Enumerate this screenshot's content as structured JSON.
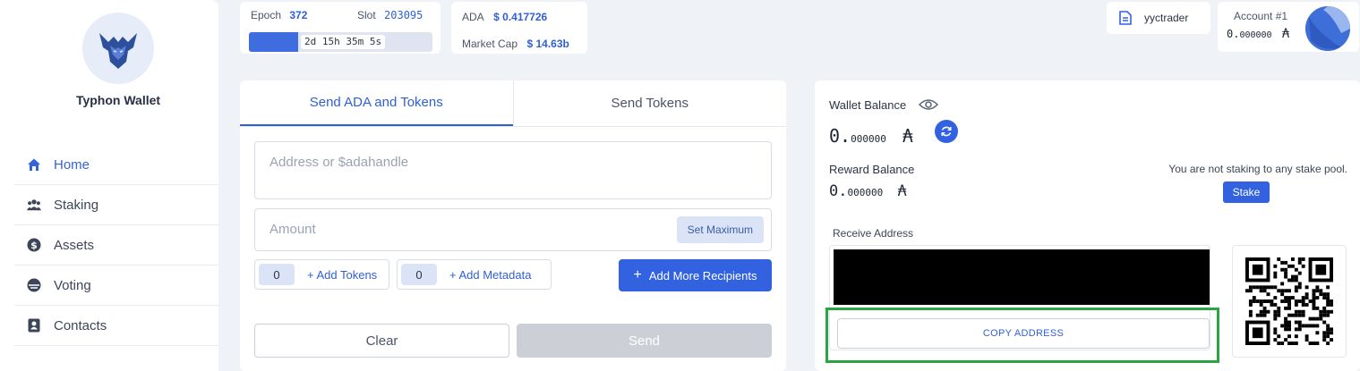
{
  "sidebar": {
    "brand": "Typhon Wallet",
    "items": [
      {
        "label": "Home",
        "icon": "home-icon",
        "active": true
      },
      {
        "label": "Staking",
        "icon": "users-icon",
        "active": false
      },
      {
        "label": "Assets",
        "icon": "dollar-icon",
        "active": false
      },
      {
        "label": "Voting",
        "icon": "voting-icon",
        "active": false
      },
      {
        "label": "Contacts",
        "icon": "contacts-icon",
        "active": false
      }
    ]
  },
  "epoch": {
    "epoch_label": "Epoch",
    "epoch_value": "372",
    "slot_label": "Slot",
    "slot_value": "203095",
    "time_remaining": "2d 15h 35m 5s",
    "progress_fraction": 0.27
  },
  "market": {
    "ada_label": "ADA",
    "ada_price": "$ 0.417726",
    "cap_label": "Market Cap",
    "cap_value": "$ 14.63b"
  },
  "user": {
    "name": "yyctrader"
  },
  "account": {
    "label": "Account #1",
    "balance_main": "0.",
    "balance_decimals": "000000",
    "symbol": "₳"
  },
  "send": {
    "tabs": [
      "Send ADA and Tokens",
      "Send Tokens"
    ],
    "address_placeholder": "Address or $adahandle",
    "amount_placeholder": "Amount",
    "set_max": "Set Maximum",
    "tokens_count": "0",
    "add_tokens": "+ Add Tokens",
    "metadata_count": "0",
    "add_metadata": "+ Add Metadata",
    "add_recipients": "Add More Recipients",
    "clear": "Clear",
    "send": "Send"
  },
  "wallet": {
    "balance_label": "Wallet Balance",
    "balance_main": "0.",
    "balance_decimals": "000000",
    "symbol": "₳",
    "reward_label": "Reward Balance",
    "reward_main": "0.",
    "reward_decimals": "000000",
    "staking_note": "You are not staking to any stake pool.",
    "stake_button": "Stake",
    "receive_label": "Receive Address",
    "copy_button": "COPY ADDRESS"
  },
  "colors": {
    "accent": "#3262e0",
    "highlight": "#2ba544"
  }
}
